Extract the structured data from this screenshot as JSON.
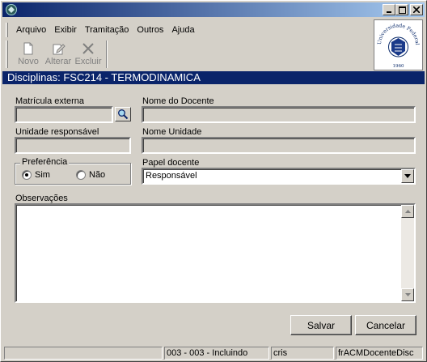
{
  "menu": {
    "items": [
      "Arquivo",
      "Exibir",
      "Tramitação",
      "Outros",
      "Ajuda"
    ]
  },
  "toolbar": {
    "novo_label": "Novo",
    "alterar_label": "Alterar",
    "excluir_label": "Excluir"
  },
  "logo": {
    "text": "Universidade Federal de Santa Maria",
    "year": "1960"
  },
  "banner": {
    "title": "Disciplinas: FSC214 - TERMODINAMICA"
  },
  "form": {
    "matricula_label": "Matrícula externa",
    "matricula_value": "",
    "docente_label": "Nome do Docente",
    "docente_value": "",
    "unidade_label": "Unidade responsável",
    "unidade_value": "",
    "nome_unidade_label": "Nome Unidade",
    "nome_unidade_value": "",
    "preferencia_label": "Preferência",
    "pref_sim": "Sim",
    "pref_nao": "Não",
    "pref_selected": "Sim",
    "papel_label": "Papel docente",
    "papel_value": "Responsável",
    "obs_label": "Observações",
    "obs_value": ""
  },
  "buttons": {
    "salvar": "Salvar",
    "cancelar": "Cancelar"
  },
  "status": {
    "panel1": "",
    "panel2": "003 - 003 - Incluindo",
    "panel3": "cris",
    "panel4": "frACMDocenteDisc"
  },
  "colors": {
    "title_bar_start": "#0a246a",
    "title_bar_end": "#a6caf0",
    "banner_bg": "#0a246a",
    "face": "#d4d0c8"
  }
}
